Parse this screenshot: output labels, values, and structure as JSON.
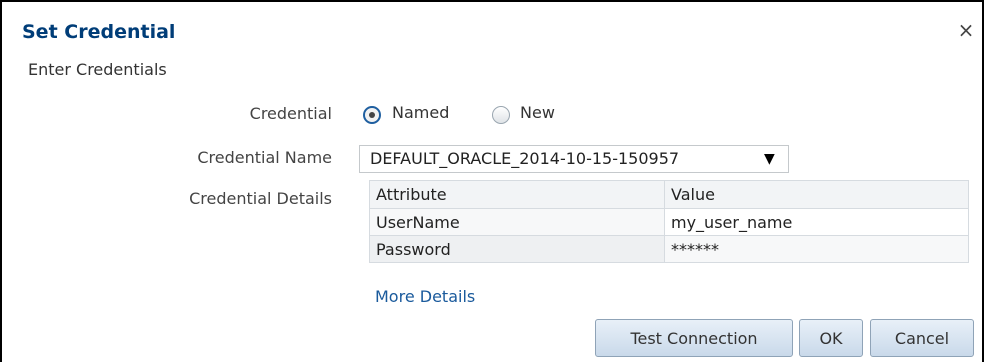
{
  "dialog": {
    "title": "Set Credential",
    "close_icon": "×",
    "subtitle": "Enter Credentials"
  },
  "form": {
    "credential_label": "Credential",
    "credential_options": [
      {
        "label": "Named",
        "selected": true
      },
      {
        "label": "New",
        "selected": false
      }
    ],
    "credential_name_label": "Credential Name",
    "credential_name_value": "DEFAULT_ORACLE_2014-10-15-150957",
    "dropdown_icon": "▼",
    "credential_details_label": "Credential Details"
  },
  "details_table": {
    "columns": [
      "Attribute",
      "Value"
    ],
    "rows": [
      {
        "attribute": "UserName",
        "value": "my_user_name"
      },
      {
        "attribute": "Password",
        "value": "******"
      }
    ]
  },
  "more_details_link": "More Details",
  "buttons": {
    "test_connection": "Test Connection",
    "ok": "OK",
    "cancel": "Cancel"
  },
  "colors": {
    "title": "#003d78",
    "link": "#1a5a9c",
    "button_top": "#e8f0f8",
    "button_bottom": "#c9d9ea"
  }
}
